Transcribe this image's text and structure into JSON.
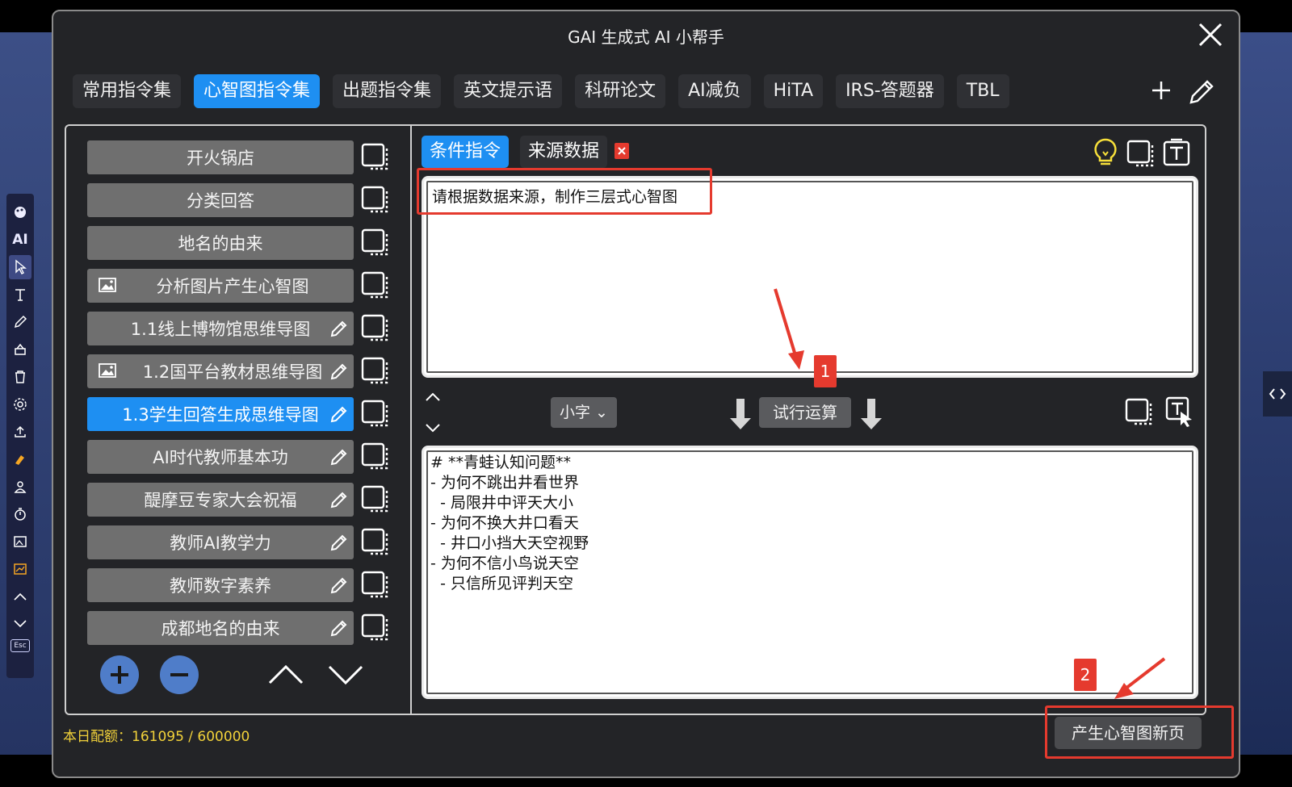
{
  "window": {
    "title": "GAI 生成式 AI 小帮手"
  },
  "tabs": [
    {
      "label": "常用指令集",
      "active": false
    },
    {
      "label": "心智图指令集",
      "active": true
    },
    {
      "label": "出题指令集",
      "active": false
    },
    {
      "label": "英文提示语",
      "active": false
    },
    {
      "label": "科研论文",
      "active": false
    },
    {
      "label": "AI减负",
      "active": false
    },
    {
      "label": "HiTA",
      "active": false
    },
    {
      "label": "IRS-答题器",
      "active": false
    },
    {
      "label": "TBL",
      "active": false
    }
  ],
  "commands": [
    {
      "label": "开火锅店",
      "image": false,
      "editable": false,
      "selected": false
    },
    {
      "label": "分类回答",
      "image": false,
      "editable": false,
      "selected": false
    },
    {
      "label": "地名的由来",
      "image": false,
      "editable": false,
      "selected": false
    },
    {
      "label": "分析图片产生心智图",
      "image": true,
      "editable": false,
      "selected": false
    },
    {
      "label": "1.1线上博物馆思维导图",
      "image": false,
      "editable": true,
      "selected": false
    },
    {
      "label": "1.2国平台教材思维导图",
      "image": true,
      "editable": true,
      "selected": false
    },
    {
      "label": "1.3学生回答生成思维导图",
      "image": false,
      "editable": true,
      "selected": true
    },
    {
      "label": "AI时代教师基本功",
      "image": false,
      "editable": true,
      "selected": false
    },
    {
      "label": "醍摩豆专家大会祝福",
      "image": false,
      "editable": true,
      "selected": false
    },
    {
      "label": "教师AI教学力",
      "image": false,
      "editable": true,
      "selected": false
    },
    {
      "label": "教师数字素养",
      "image": false,
      "editable": true,
      "selected": false
    },
    {
      "label": "成都地名的由来",
      "image": false,
      "editable": true,
      "selected": false
    }
  ],
  "right": {
    "tab_condition": "条件指令",
    "tab_source": "来源数据",
    "prompt": "请根据数据来源，制作三层式心智图",
    "font_size": "小字 ⌄",
    "run_label": "试行运算",
    "output": "# **青蛙认知问题**\n- 为何不跳出井看世界\n  - 局限井中评天大小\n- 为何不换大井口看天\n  - 井口小挡大天空视野\n- 为何不信小鸟说天空\n  - 只信所见评判天空"
  },
  "footer": {
    "quota": "本日配额：161095 / 600000",
    "new_page_button": "产生心智图新页"
  },
  "annotations": {
    "badge1": "1",
    "badge2": "2",
    "color": "#e53a2e"
  },
  "colors": {
    "accent": "#1e8ff2",
    "quota": "#f2d23a"
  },
  "side_toolbar": {
    "ai_label": "AI",
    "esc_label": "Esc"
  }
}
